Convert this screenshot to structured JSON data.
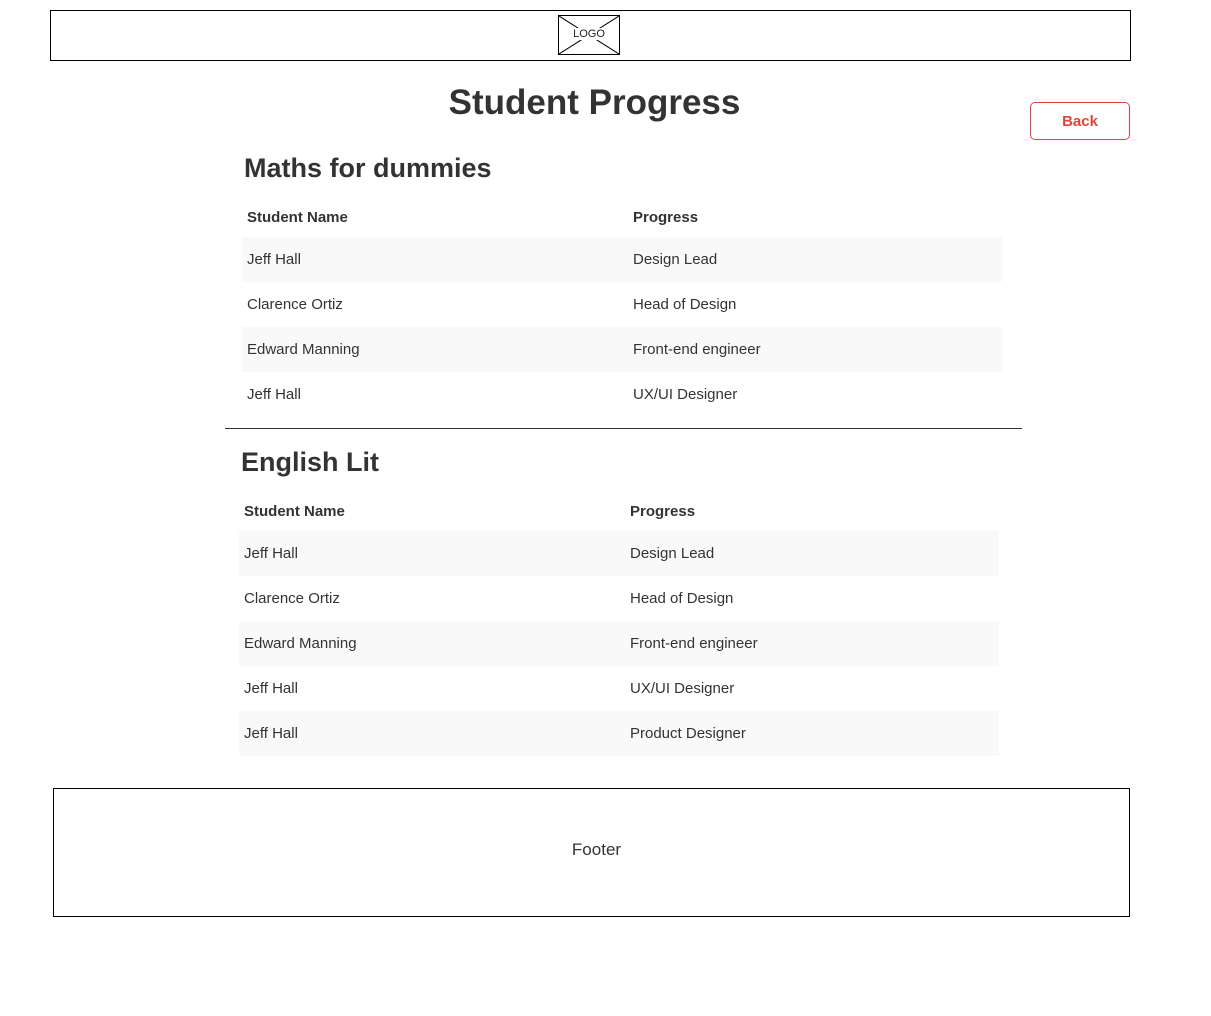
{
  "header": {
    "logo_text": "LOGO"
  },
  "page": {
    "title": "Student Progress",
    "back_label": "Back"
  },
  "courses": [
    {
      "title": "Maths for dummies",
      "columns": [
        "Student Name",
        "Progress"
      ],
      "rows": [
        {
          "name": "Jeff Hall",
          "progress": "Design Lead"
        },
        {
          "name": "Clarence Ortiz",
          "progress": "Head of Design"
        },
        {
          "name": "Edward Manning",
          "progress": "Front-end engineer"
        },
        {
          "name": "Jeff Hall",
          "progress": "UX/UI Designer"
        }
      ]
    },
    {
      "title": "English Lit",
      "columns": [
        "Student Name",
        "Progress"
      ],
      "rows": [
        {
          "name": "Jeff Hall",
          "progress": "Design Lead"
        },
        {
          "name": "Clarence Ortiz",
          "progress": "Head of Design"
        },
        {
          "name": "Edward Manning",
          "progress": "Front-end engineer"
        },
        {
          "name": "Jeff Hall",
          "progress": "UX/UI Designer"
        },
        {
          "name": "Jeff Hall",
          "progress": "Product Designer"
        }
      ]
    }
  ],
  "footer": {
    "text": "Footer"
  },
  "colors": {
    "accent": "#e0443a",
    "row_stripe": "#f9f9f9",
    "text": "#333333"
  }
}
